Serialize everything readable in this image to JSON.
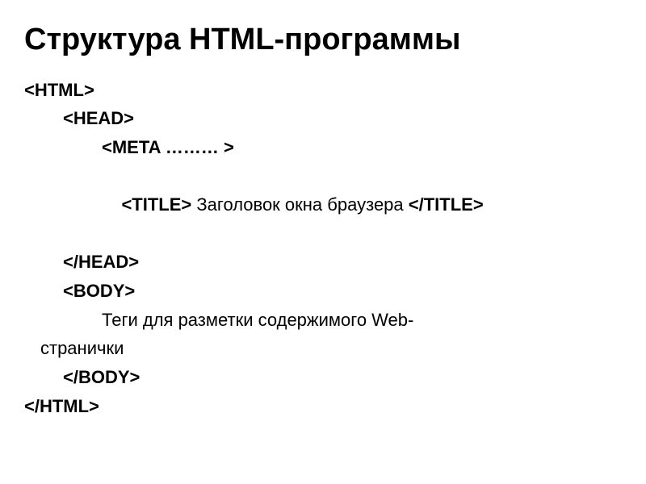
{
  "slide": {
    "title": "Структура HTML-программы",
    "lines": [
      {
        "indent": "indent-0",
        "bold": true,
        "text": "<HTML>"
      },
      {
        "indent": "indent-1",
        "bold": true,
        "text": "<HEAD>"
      },
      {
        "indent": "indent-2",
        "bold": true,
        "text": "<META ……… >"
      },
      {
        "indent": "indent-2",
        "bold": false,
        "prefix": "<TITLE> ",
        "mid": "Заголовок окна браузера ",
        "suffix": "</TITLE>"
      },
      {
        "indent": "indent-1",
        "bold": true,
        "text": "</HEAD>"
      },
      {
        "indent": "indent-1",
        "bold": true,
        "text": "<BODY>"
      },
      {
        "indent": "indent-2",
        "bold": false,
        "text": "Теги для разметки содержимого Web-"
      },
      {
        "indent": "wrap-continue",
        "bold": false,
        "text": "странички"
      },
      {
        "indent": "indent-1",
        "bold": true,
        "text": "</BODY>"
      },
      {
        "indent": "indent-0",
        "bold": true,
        "text": "</HTML>"
      }
    ]
  }
}
